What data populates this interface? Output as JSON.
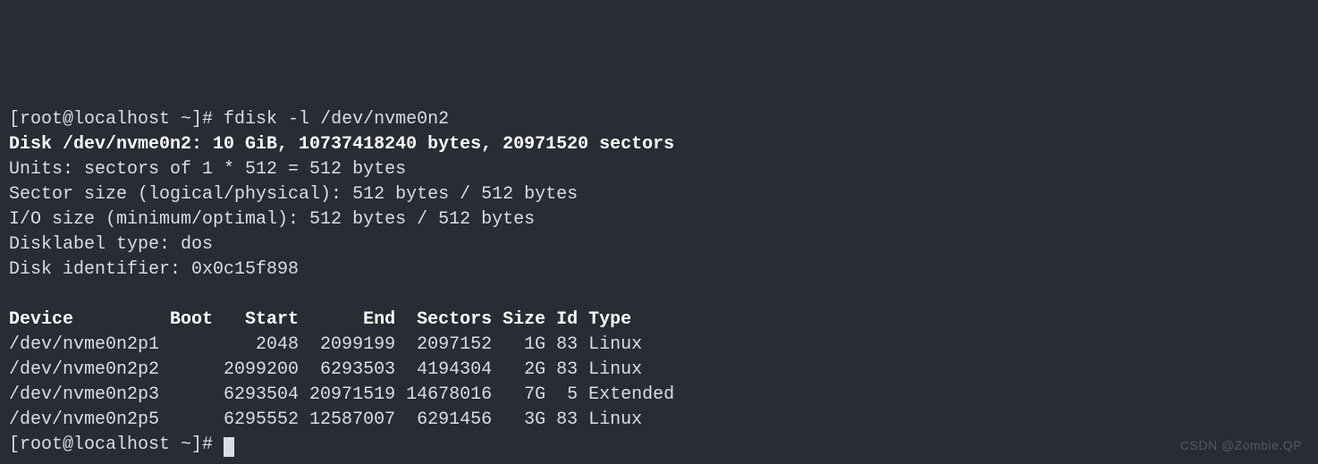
{
  "prompt1": {
    "text": "[root@localhost ~]# ",
    "command": "fdisk -l /dev/nvme0n2"
  },
  "disk_summary": "Disk /dev/nvme0n2: 10 GiB, 10737418240 bytes, 20971520 sectors",
  "units": "Units: sectors of 1 * 512 = 512 bytes",
  "sector_size": "Sector size (logical/physical): 512 bytes / 512 bytes",
  "io_size": "I/O size (minimum/optimal): 512 bytes / 512 bytes",
  "disklabel": "Disklabel type: dos",
  "diskid": "Disk identifier: 0x0c15f898",
  "table": {
    "header": "Device         Boot   Start      End  Sectors Size Id Type",
    "rows": [
      "/dev/nvme0n2p1         2048  2099199  2097152   1G 83 Linux",
      "/dev/nvme0n2p2      2099200  6293503  4194304   2G 83 Linux",
      "/dev/nvme0n2p3      6293504 20971519 14678016   7G  5 Extended",
      "/dev/nvme0n2p5      6295552 12587007  6291456   3G 83 Linux"
    ]
  },
  "prompt2": "[root@localhost ~]# ",
  "watermark": "CSDN @Zombie.QP",
  "chart_data": {
    "type": "table",
    "title": "fdisk -l /dev/nvme0n2",
    "columns": [
      "Device",
      "Boot",
      "Start",
      "End",
      "Sectors",
      "Size",
      "Id",
      "Type"
    ],
    "rows": [
      {
        "Device": "/dev/nvme0n2p1",
        "Boot": "",
        "Start": 2048,
        "End": 2099199,
        "Sectors": 2097152,
        "Size": "1G",
        "Id": "83",
        "Type": "Linux"
      },
      {
        "Device": "/dev/nvme0n2p2",
        "Boot": "",
        "Start": 2099200,
        "End": 6293503,
        "Sectors": 4194304,
        "Size": "2G",
        "Id": "83",
        "Type": "Linux"
      },
      {
        "Device": "/dev/nvme0n2p3",
        "Boot": "",
        "Start": 6293504,
        "End": 20971519,
        "Sectors": 14678016,
        "Size": "7G",
        "Id": "5",
        "Type": "Extended"
      },
      {
        "Device": "/dev/nvme0n2p5",
        "Boot": "",
        "Start": 6295552,
        "End": 12587007,
        "Sectors": 6291456,
        "Size": "3G",
        "Id": "83",
        "Type": "Linux"
      }
    ]
  }
}
